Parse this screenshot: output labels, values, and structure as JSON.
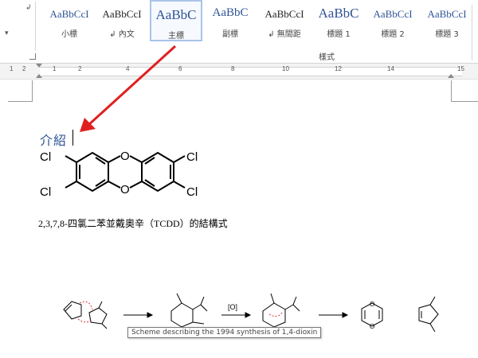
{
  "ribbon": {
    "side_arrow": "↲",
    "side_dropdown": "▾",
    "styles": [
      {
        "sample": "AaBbCcI",
        "label": "小標",
        "selected": false
      },
      {
        "sample": "AaBbCcI",
        "label": "↲ 內文",
        "selected": false
      },
      {
        "sample": "AaBbC",
        "label": "主標",
        "selected": true
      },
      {
        "sample": "AaBbC",
        "label": "副標",
        "selected": false
      },
      {
        "sample": "AaBbCcI",
        "label": "↲ 無間距",
        "selected": false
      },
      {
        "sample": "AaBbC",
        "label": "標題 1",
        "selected": false
      },
      {
        "sample": "AaBbCcI",
        "label": "標題 2",
        "selected": false
      },
      {
        "sample": "AaBbCcI",
        "label": "標題 3",
        "selected": false
      }
    ],
    "group_label": "樣式"
  },
  "ruler": {
    "numbers": [
      "1",
      "2",
      "1",
      "2",
      "4",
      "6",
      "8",
      "10",
      "12",
      "14",
      "15"
    ]
  },
  "document": {
    "heading": "介紹",
    "tcdd": {
      "atom_labels": [
        "Cl",
        "Cl",
        "Cl",
        "Cl",
        "O",
        "O"
      ]
    },
    "caption": "2,3,7,8-四氯二苯並戴奧辛（TCDD）的結構式",
    "scheme": {
      "reagent": "[O]",
      "atom_label": "O"
    },
    "tooltip": "Scheme describing the 1994 synthesis of 1,4-dioxin"
  },
  "colors": {
    "accent": "#2f5496",
    "arrow": "#e02020",
    "selected_border": "#a9c4e8",
    "electron_arrows": "#e03030"
  },
  "icons": {
    "pointer_arrow": "red-arrow-icon",
    "dialog_launcher": "dialog-launcher-icon"
  }
}
